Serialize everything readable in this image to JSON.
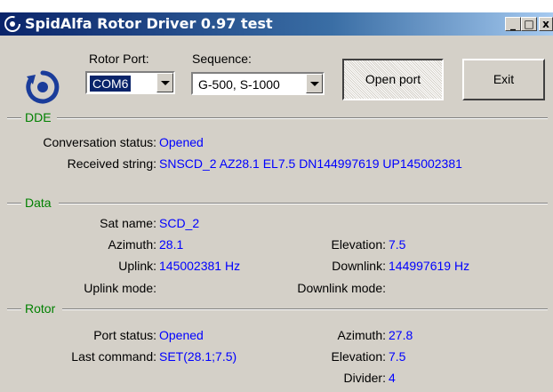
{
  "window": {
    "title": "SpidAlfa Rotor Driver 0.97 test",
    "controls": {
      "minimize": "_",
      "maximize": "□",
      "close": "x"
    }
  },
  "toolbar": {
    "rotor_port_label": "Rotor Port:",
    "rotor_port_value": "COM6",
    "sequence_label": "Sequence:",
    "sequence_value": "G-500, S-1000",
    "open_port_label": "Open port",
    "exit_label": "Exit"
  },
  "dde": {
    "group_label": "DDE",
    "conversation_status_label": "Conversation status:",
    "conversation_status_value": "Opened",
    "received_string_label": "Received string:",
    "received_string_value": "SNSCD_2 AZ28.1 EL7.5 DN144997619 UP145002381"
  },
  "data": {
    "group_label": "Data",
    "sat_name_label": "Sat name:",
    "sat_name_value": "SCD_2",
    "azimuth_label": "Azimuth:",
    "azimuth_value": "28.1",
    "elevation_label": "Elevation:",
    "elevation_value": "7.5",
    "uplink_label": "Uplink:",
    "uplink_value": "145002381 Hz",
    "downlink_label": "Downlink:",
    "downlink_value": "144997619 Hz",
    "uplink_mode_label": "Uplink mode:",
    "downlink_mode_label": "Downlink mode:"
  },
  "rotor": {
    "group_label": "Rotor",
    "port_status_label": "Port status:",
    "port_status_value": "Opened",
    "last_command_label": "Last command:",
    "last_command_value": "SET(28.1;7.5)",
    "azimuth_label": "Azimuth:",
    "azimuth_value": "27.8",
    "elevation_label": "Elevation:",
    "elevation_value": "7.5",
    "divider_label": "Divider:",
    "divider_value": "4"
  },
  "colors": {
    "value_text": "#0000ff",
    "group_label": "#008000",
    "titlebar": "#0a246a",
    "face": "#d4d0c8"
  }
}
